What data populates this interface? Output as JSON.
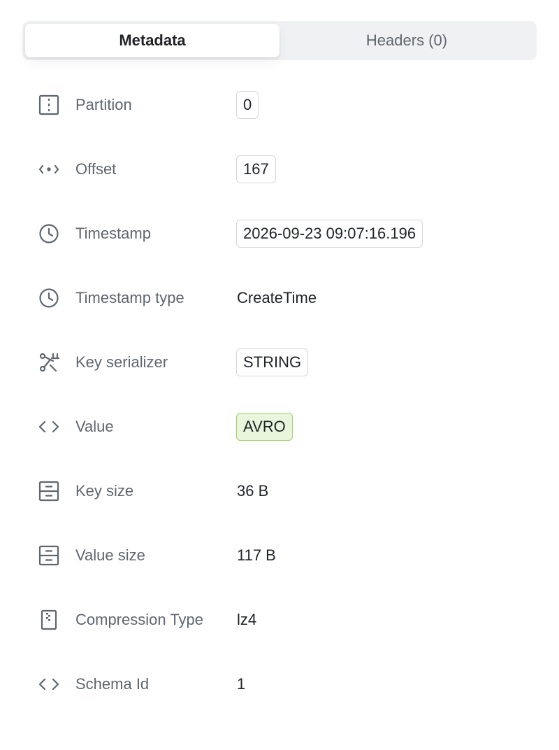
{
  "tabs": [
    {
      "label": "Metadata",
      "active": true
    },
    {
      "label": "Headers (0)",
      "active": false
    }
  ],
  "rows": [
    {
      "icon": "partition-icon",
      "label": "Partition",
      "value": "0",
      "style": "boxed"
    },
    {
      "icon": "offset-icon",
      "label": "Offset",
      "value": "167",
      "style": "boxed"
    },
    {
      "icon": "clock-icon",
      "label": "Timestamp",
      "value": "2026-09-23 09:07:16.196",
      "style": "boxed"
    },
    {
      "icon": "clock-icon",
      "label": "Timestamp type",
      "value": "CreateTime",
      "style": "plain"
    },
    {
      "icon": "serializer-icon",
      "label": "Key serializer",
      "value": "STRING",
      "style": "boxed"
    },
    {
      "icon": "code-icon",
      "label": "Value",
      "value": "AVRO",
      "style": "badge-green"
    },
    {
      "icon": "drawer-icon",
      "label": "Key size",
      "value": "36 B",
      "style": "plain"
    },
    {
      "icon": "drawer-icon",
      "label": "Value size",
      "value": "117 B",
      "style": "plain"
    },
    {
      "icon": "zip-file-icon",
      "label": "Compression Type",
      "value": "lz4",
      "style": "plain"
    },
    {
      "icon": "code-icon",
      "label": "Schema Id",
      "value": "1",
      "style": "plain"
    }
  ],
  "colors": {
    "label": "#5f6670",
    "value": "#1f2328",
    "tab_bg": "#f0f1f3",
    "badge_green_bg": "#eaf6dc",
    "badge_green_border": "#9fcf6d"
  }
}
